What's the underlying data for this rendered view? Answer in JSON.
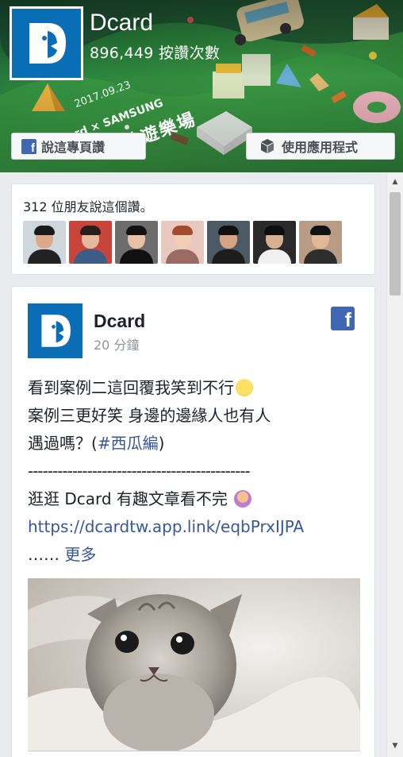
{
  "header": {
    "page_name": "Dcard",
    "likes_text": "896,449 按讚次數",
    "event_date": "2017.09.23",
    "event_brand": "Dcard × SAMSUNG",
    "event_title": "地遊樂場",
    "like_page_button": "說這專頁讚",
    "use_app_button": "使用應用程式"
  },
  "friends": {
    "text": "312 位朋友說這個讚。",
    "avatars": [
      {
        "name": "friend-1",
        "bg": "#cfd6dc",
        "skin": "#d9a98a",
        "hair": "#1a1a1a",
        "shirt": "#222"
      },
      {
        "name": "friend-2",
        "bg": "#c7453b",
        "skin": "#e4b99c",
        "hair": "#2a1e1a",
        "shirt": "#3b5d86"
      },
      {
        "name": "friend-3",
        "bg": "#6d6d6d",
        "skin": "#e6c1a5",
        "hair": "#111",
        "shirt": "#111"
      },
      {
        "name": "friend-4",
        "bg": "#e8c8bf",
        "skin": "#f1cdb5",
        "hair": "#a44a2f",
        "shirt": "#9b6a63"
      },
      {
        "name": "friend-5",
        "bg": "#4c5a63",
        "skin": "#d4a483",
        "hair": "#111",
        "shirt": "#1d1d1d"
      },
      {
        "name": "friend-6",
        "bg": "#2a2a2a",
        "skin": "#d8b08f",
        "hair": "#0e0e0e",
        "shirt": "#f0f0f0"
      },
      {
        "name": "friend-7",
        "bg": "#b89c86",
        "skin": "#e1b796",
        "hair": "#121212",
        "shirt": "#2d2d2d"
      }
    ]
  },
  "post": {
    "author": "Dcard",
    "time": "20 分鐘",
    "line1": "看到案例二這回覆我笑到不行",
    "line2": "案例三更好笑 身邊的邊緣人也有人",
    "line3_prefix": "遇過嗎？(",
    "hashtag": "#西瓜編",
    "line3_suffix": ")",
    "divider": "---------------------------------------------",
    "line5": "逛逛 Dcard 有趣文章看不完",
    "link": "https://dcardtw.app.link/eqbPrxIJPA",
    "ellipsis": "……",
    "see_more": "更多"
  },
  "colors": {
    "brand": "#0a6eb7",
    "facebook": "#4267b2",
    "link": "#365899"
  }
}
